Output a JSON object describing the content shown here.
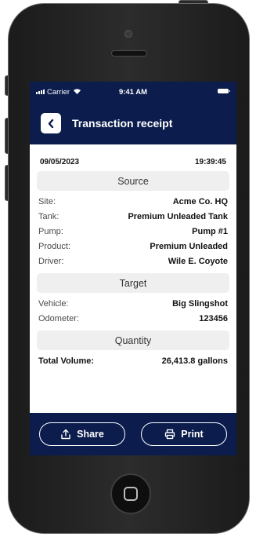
{
  "status_bar": {
    "carrier": "Carrier",
    "time": "9:41 AM",
    "icons": [
      "signal-icon",
      "wifi-icon",
      "battery-icon"
    ]
  },
  "header": {
    "title": "Transaction receipt",
    "back_icon": "chevron-left-icon"
  },
  "receipt": {
    "date": "09/05/2023",
    "time": "19:39:45",
    "source": {
      "header": "Source",
      "fields": [
        {
          "label": "Site:",
          "value": "Acme Co. HQ"
        },
        {
          "label": "Tank:",
          "value": "Premium Unleaded Tank"
        },
        {
          "label": "Pump:",
          "value": "Pump #1"
        },
        {
          "label": "Product:",
          "value": "Premium Unleaded"
        },
        {
          "label": "Driver:",
          "value": "Wile E. Coyote"
        }
      ]
    },
    "target": {
      "header": "Target",
      "fields": [
        {
          "label": "Vehicle:",
          "value": "Big Slingshot"
        },
        {
          "label": "Odometer:",
          "value": "123456"
        }
      ]
    },
    "quantity": {
      "header": "Quantity",
      "fields": [
        {
          "label": "Total Volume:",
          "value": "26,413.8 gallons"
        }
      ]
    }
  },
  "actions": {
    "share_label": "Share",
    "print_label": "Print",
    "share_icon": "share-icon",
    "print_icon": "printer-icon"
  },
  "colors": {
    "primary": "#0b1c4d",
    "section_bg": "#efefef",
    "text": "#111111"
  }
}
